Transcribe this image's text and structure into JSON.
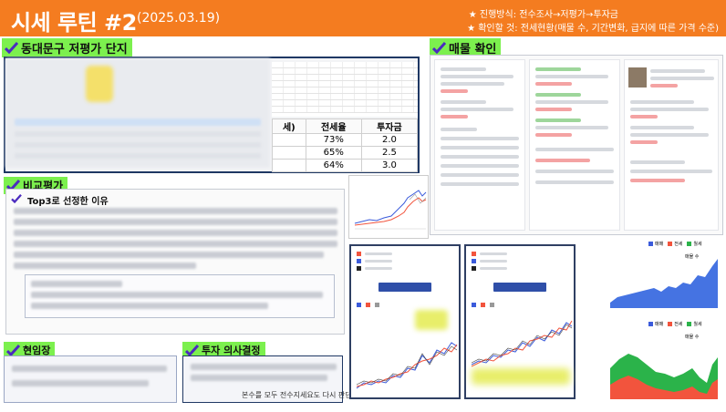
{
  "header": {
    "title": "시세 루틴 #2",
    "date": "(2025.03.19)",
    "note1": "★ 진행방식: 전수조사→저평가→투자금",
    "note2": "★ 확인할 것: 전세현황(매물 수, 기간변화, 급지에 따른 가격 수준)"
  },
  "sections": {
    "dongdaemun": "동대문구 저평가 단지",
    "listings": "매물 확인",
    "comparison": "비교평가",
    "top3": "Top3로 선정한 이유",
    "field": "현임장",
    "decision": "투자 의사결정"
  },
  "summary_table": {
    "headers": [
      "세)",
      "전세율",
      "투자금"
    ],
    "rows": [
      [
        "",
        "73%",
        "2.0"
      ],
      [
        "",
        "65%",
        "2.5"
      ],
      [
        "",
        "64%",
        "3.0"
      ]
    ]
  },
  "decision_footer": "본수를 모두 전수지세요도 다시 판단 정자.",
  "chart_bottom_right": {
    "legend": [
      "매매",
      "전세",
      "월세"
    ],
    "label_top": "매물 수",
    "label_area": "매물 수"
  },
  "colors": {
    "header": "#f47c20",
    "label": "#7cf04e",
    "navy": "#1f3864",
    "sale": "#3b5bdb",
    "jeonse": "#f2543d",
    "wolse": "#2bb34a"
  }
}
